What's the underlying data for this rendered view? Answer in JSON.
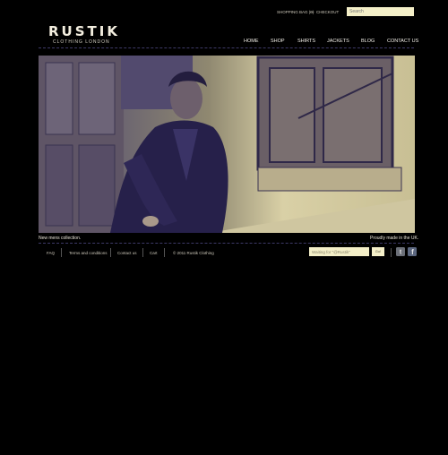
{
  "header": {
    "logo_title": "RUSTIK",
    "logo_subtitle": "CLOTHING LONDON",
    "shopping_bag": "SHOPPING BAG (0)",
    "separator": "—",
    "checkout": "CHECKOUT",
    "search_placeholder": "Search"
  },
  "nav": {
    "items": [
      "HOME",
      "SHOP",
      "SHIRTS",
      "JACKETS",
      "BLOG",
      "CONTACT US"
    ]
  },
  "hero": {
    "caption_left": "New mens collection.",
    "caption_right": "Proudly made in the UK."
  },
  "footer": {
    "links": [
      "FAQ",
      "Terms and conditions",
      "Contact us",
      "Cart"
    ],
    "copyright": "© 2011 Rustik Clothing",
    "twitter_input": "Waiting for \"@Rustik\"",
    "go_label": "Go!",
    "social_icons": [
      "twitter-icon",
      "facebook-icon"
    ]
  },
  "colors": {
    "background": "#000000",
    "accent_cream": "#f4efc8",
    "tint_indigo": "#3a3560"
  }
}
